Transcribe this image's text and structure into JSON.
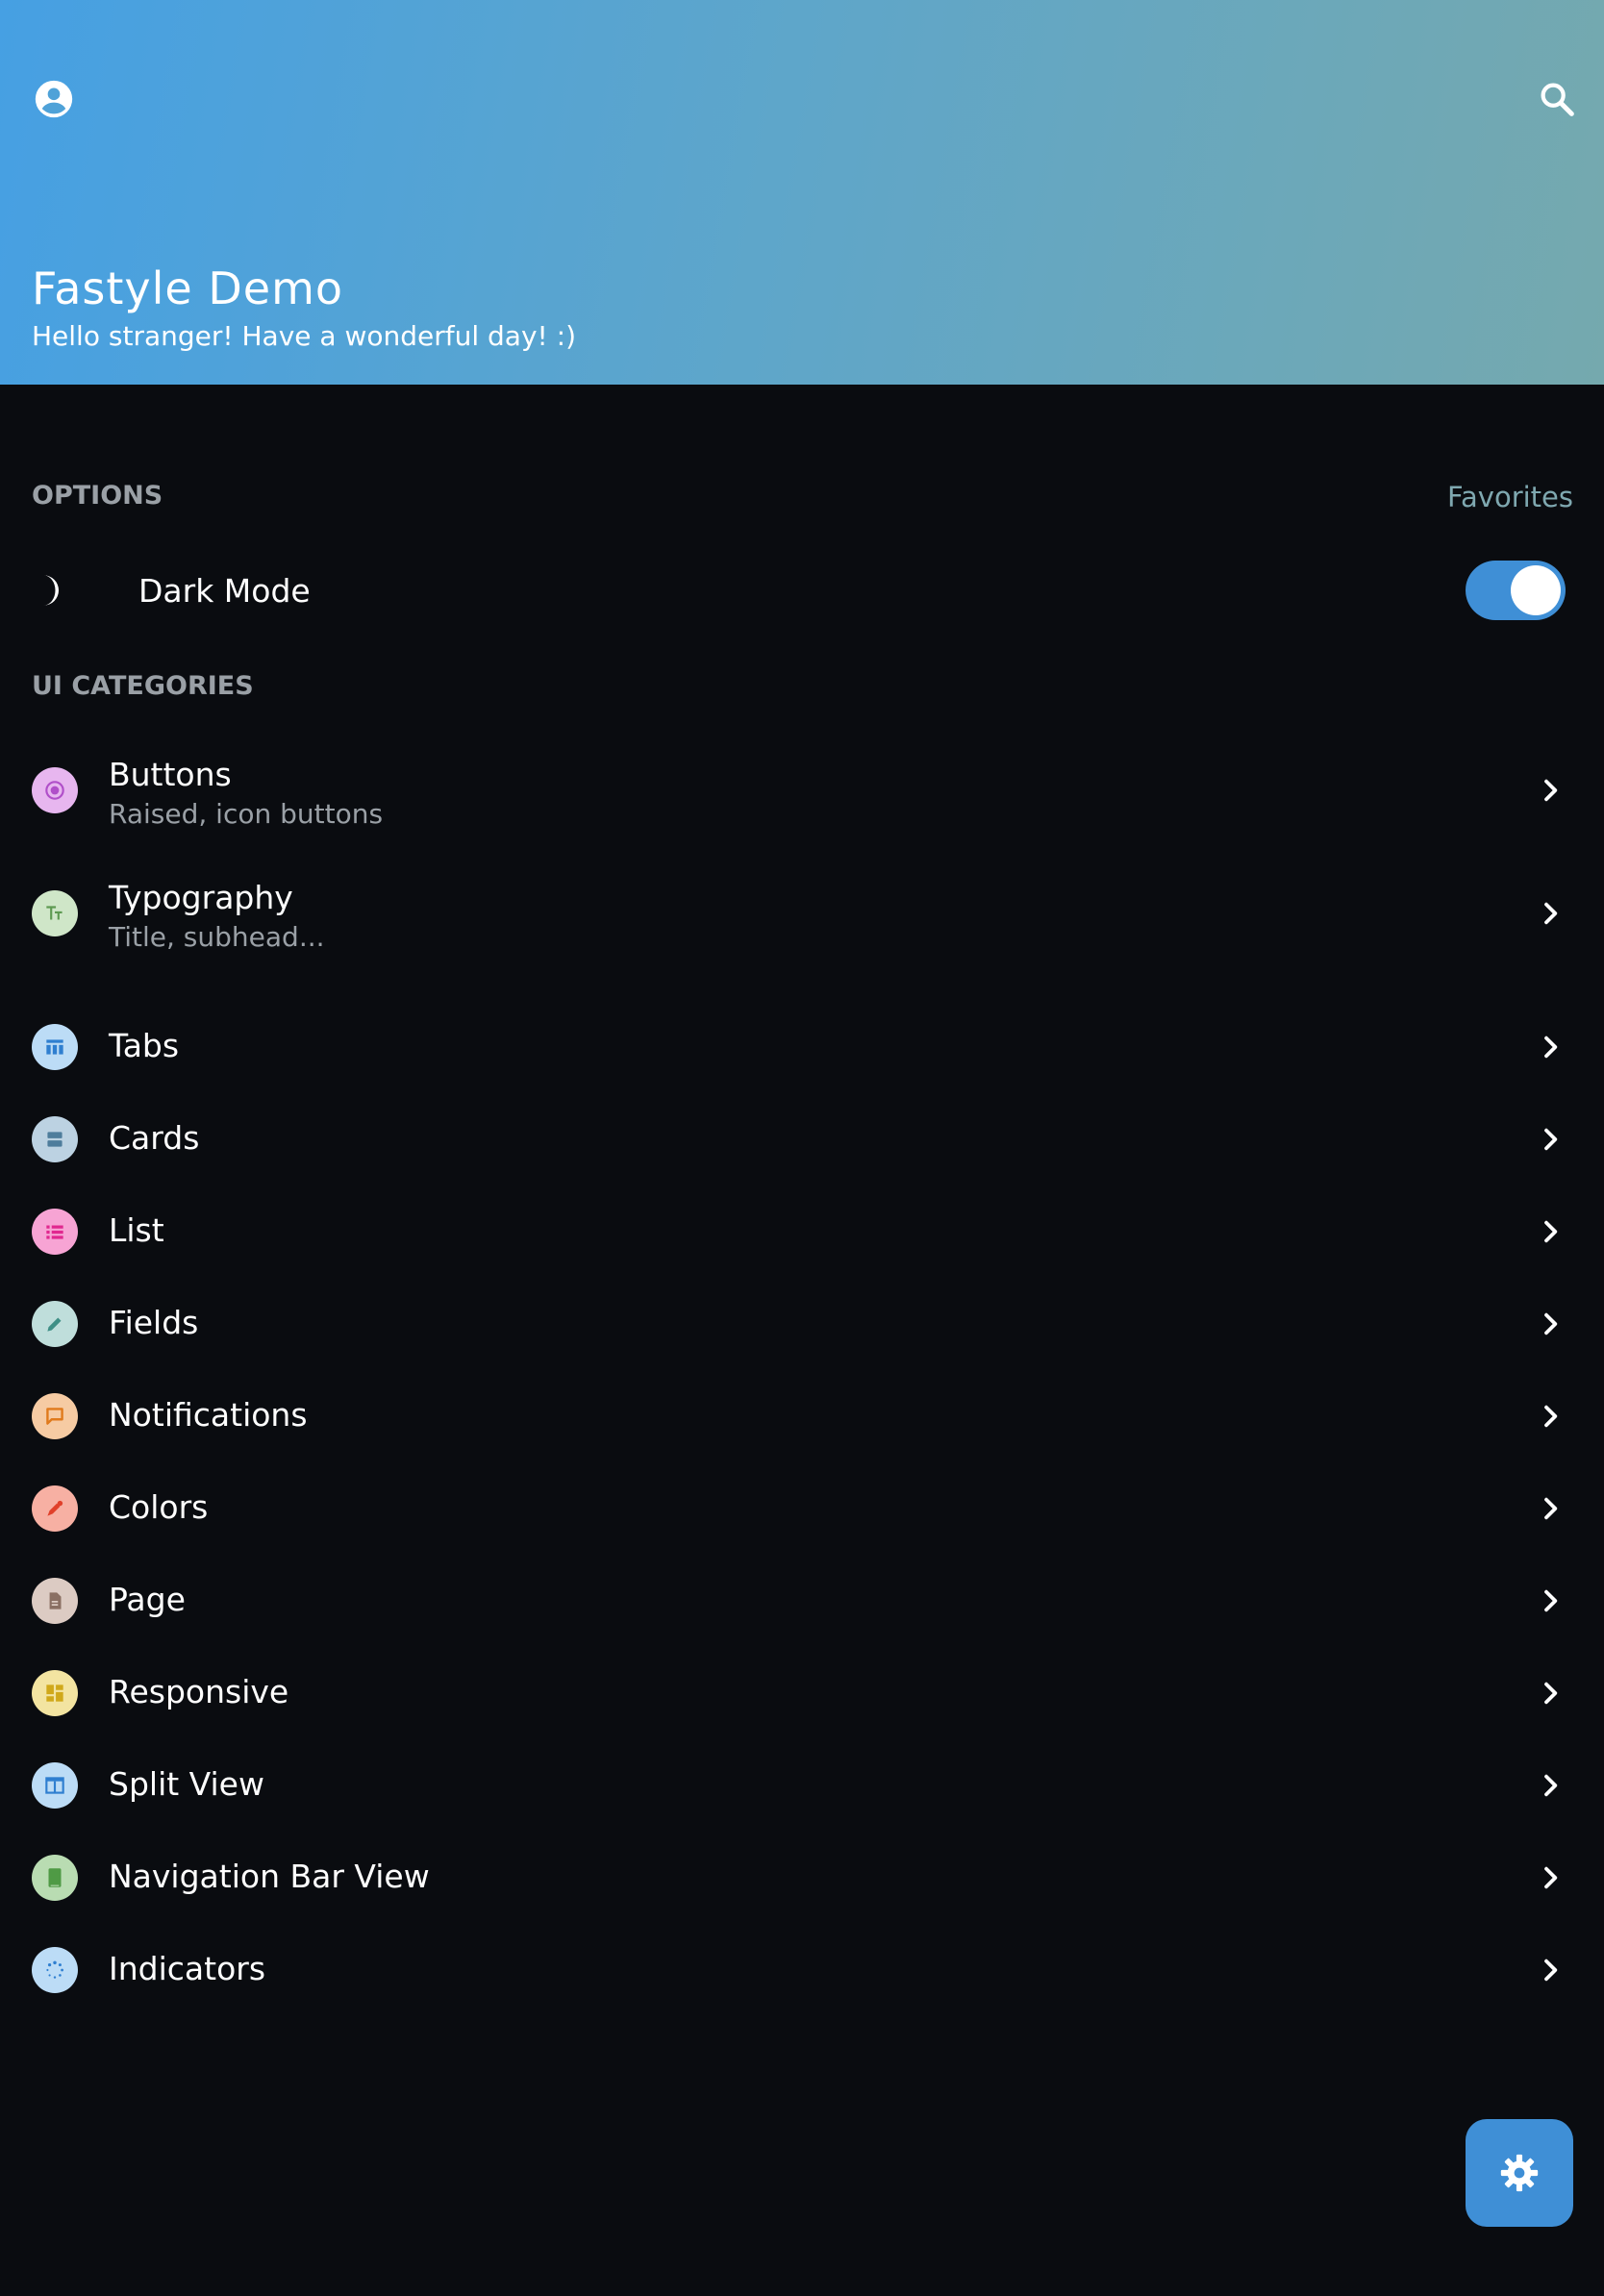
{
  "header": {
    "title": "Fastyle Demo",
    "subtitle": "Hello stranger! Have a wonderful day! :)",
    "left_icon": "account-circle-icon",
    "right_icon": "search-icon"
  },
  "options": {
    "section_label": "OPTIONS",
    "favorites_label": "Favorites",
    "dark_mode_label": "Dark Mode",
    "dark_mode_on": true,
    "dark_mode_icon": "moon-icon"
  },
  "categories": {
    "section_label": "UI CATEGORIES",
    "items": [
      {
        "title": "Buttons",
        "subtitle": "Raised, icon buttons",
        "icon": "radio-button-icon",
        "icon_color": "#b04fc9",
        "icon_bg": "#e7b6ef"
      },
      {
        "title": "Typography",
        "subtitle": "Title, subhead...",
        "icon": "text-fields-icon",
        "icon_color": "#5e9a52",
        "icon_bg": "#cfe6c8"
      },
      {
        "title": "Tabs",
        "icon": "tabs-icon",
        "icon_color": "#2f7fd0",
        "icon_bg": "#bcdcf6"
      },
      {
        "title": "Cards",
        "icon": "cards-icon",
        "icon_color": "#4e7d9c",
        "icon_bg": "#bcd2e2"
      },
      {
        "title": "List",
        "icon": "list-icon",
        "icon_color": "#e0288f",
        "icon_bg": "#f7a4d4"
      },
      {
        "title": "Fields",
        "icon": "pencil-icon",
        "icon_color": "#3f8f86",
        "icon_bg": "#bfdedb"
      },
      {
        "title": "Notifications",
        "icon": "chat-bubble-icon",
        "icon_color": "#e07a1c",
        "icon_bg": "#f6cba3"
      },
      {
        "title": "Colors",
        "icon": "eyedropper-icon",
        "icon_color": "#e0402a",
        "icon_bg": "#f7b0a3"
      },
      {
        "title": "Page",
        "icon": "document-icon",
        "icon_color": "#8a6f63",
        "icon_bg": "#dccbc3"
      },
      {
        "title": "Responsive",
        "icon": "dashboard-icon",
        "icon_color": "#d0a81a",
        "icon_bg": "#f3e4a1"
      },
      {
        "title": "Split View",
        "icon": "split-view-icon",
        "icon_color": "#2f7fd0",
        "icon_bg": "#bcdcf6"
      },
      {
        "title": "Navigation Bar View",
        "icon": "tablet-icon",
        "icon_color": "#4f9a45",
        "icon_bg": "#b9dcb2"
      },
      {
        "title": "Indicators",
        "icon": "spinner-icon",
        "icon_color": "#2f7fd0",
        "icon_bg": "#bcdcf6"
      }
    ]
  },
  "fab": {
    "icon": "gear-icon"
  },
  "colors": {
    "background": "#0a0c10",
    "accent": "#3f8fd6",
    "header_gradient": [
      "#46a0e3",
      "#75a9ae"
    ]
  }
}
